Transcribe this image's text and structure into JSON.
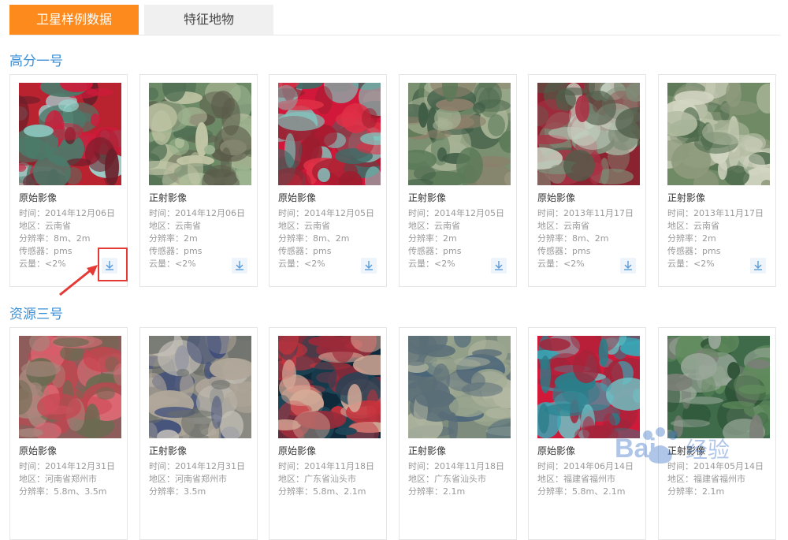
{
  "tabs": {
    "active": "卫星样例数据",
    "inactive": "特征地物"
  },
  "sections": [
    {
      "title": "高分一号",
      "cards": [
        {
          "title": "原始影像",
          "time": "时间：2014年12月06日",
          "region": "地区：云南省",
          "res": "分辨率：8m、2m",
          "sensor": "传感器：pms",
          "cloud": "云量：<2%",
          "palette": [
            "#b8232f",
            "#d11a3a",
            "#4b7a6a",
            "#9ad6d0",
            "#6b1f2a"
          ]
        },
        {
          "title": "正射影像",
          "time": "时间：2014年12月06日",
          "region": "地区：云南省",
          "res": "分辨率：2m",
          "sensor": "传感器：pms",
          "cloud": "云量：<2%",
          "palette": [
            "#6d8a67",
            "#9bb38f",
            "#4f6e52",
            "#c4c8a8",
            "#5b5b4a"
          ]
        },
        {
          "title": "原始影像",
          "time": "时间：2014年12月05日",
          "region": "地区：云南省",
          "res": "分辨率：8m、2m",
          "sensor": "传感器：pms",
          "cloud": "云量：<2%",
          "palette": [
            "#d1183a",
            "#9b1d2e",
            "#7fc7c0",
            "#3e6b66",
            "#e03046"
          ]
        },
        {
          "title": "正射影像",
          "time": "时间：2014年12月05日",
          "region": "地区：云南省",
          "res": "分辨率：2m",
          "sensor": "传感器：pms",
          "cloud": "云量：<2%",
          "palette": [
            "#7a9070",
            "#5b7a58",
            "#a7b395",
            "#8d7f6a",
            "#3f5b45"
          ]
        },
        {
          "title": "原始影像",
          "time": "时间：2013年11月17日",
          "region": "地区：云南省",
          "res": "分辨率：8m、2m",
          "sensor": "传感器：pms",
          "cloud": "云量：<2%",
          "palette": [
            "#8a2230",
            "#c7d2c2",
            "#4f5e4a",
            "#a93345",
            "#7f8d78"
          ]
        },
        {
          "title": "正射影像",
          "time": "时间：2013年11月17日",
          "region": "地区：云南省",
          "res": "分辨率：2m",
          "sensor": "传感器：pms",
          "cloud": "云量：<2%",
          "palette": [
            "#6f8a64",
            "#b6bfa4",
            "#4d6a4c",
            "#8e9a7c",
            "#d3d6c3"
          ]
        }
      ]
    },
    {
      "title": "资源三号",
      "cards": [
        {
          "title": "原始影像",
          "time": "时间：2014年12月31日",
          "region": "地区：河南省郑州市",
          "res": "分辨率：5.8m、3.5m",
          "palette": [
            "#8e5c5a",
            "#c7434f",
            "#6b6b52",
            "#a7877c",
            "#e06a76"
          ]
        },
        {
          "title": "正射影像",
          "time": "时间：2014年12月31日",
          "region": "地区：河南省郑州市",
          "res": "分辨率：3.5m",
          "palette": [
            "#8a8a82",
            "#b0a79a",
            "#6b6f6a",
            "#c4c0b8",
            "#3f4d7a"
          ]
        },
        {
          "title": "原始影像",
          "time": "时间：2014年11月18日",
          "region": "地区：广东省汕头市",
          "res": "分辨率：5.8m、2.1m",
          "palette": [
            "#0f2a3a",
            "#c8323c",
            "#1e4658",
            "#d6aa98",
            "#9b2a3a"
          ]
        },
        {
          "title": "正射影像",
          "time": "时间：2014年11月18日",
          "region": "地区：广东省汕头市",
          "res": "分辨率：2.1m",
          "palette": [
            "#7d8c7d",
            "#5a6e78",
            "#9aa58e",
            "#45627a",
            "#b3b8a2"
          ]
        },
        {
          "title": "原始影像",
          "time": "时间：2014年06月14日",
          "region": "地区：福建省福州市",
          "res": "分辨率：5.8m、2.1m",
          "palette": [
            "#d11a3a",
            "#3aa5b5",
            "#6bc4c7",
            "#a4243a",
            "#2a7e8a"
          ]
        },
        {
          "title": "正射影像",
          "time": "时间：2014年05月14日",
          "region": "地区：福建省福州市",
          "res": "分辨率：2.1m",
          "palette": [
            "#3f6b4a",
            "#5f8a5c",
            "#2e5236",
            "#9aa89a",
            "#7c7f78"
          ]
        }
      ]
    }
  ],
  "watermark": "Bai 经验"
}
